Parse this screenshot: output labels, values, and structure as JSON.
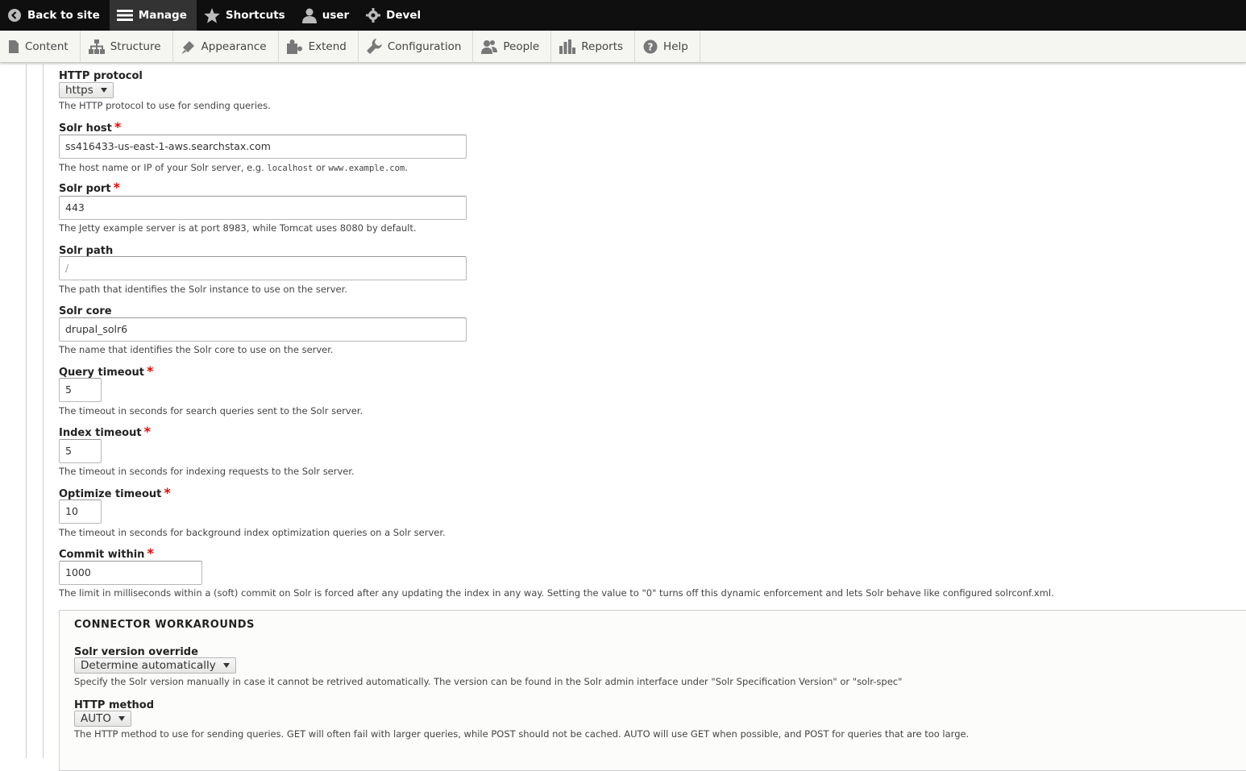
{
  "toolbar": {
    "items": [
      {
        "label": "Back to site",
        "icon": "back-circle-icon"
      },
      {
        "label": "Manage",
        "icon": "menu-icon"
      },
      {
        "label": "Shortcuts",
        "icon": "star-icon"
      },
      {
        "label": "user",
        "icon": "user-icon"
      },
      {
        "label": "Devel",
        "icon": "gear-icon"
      }
    ]
  },
  "tray": {
    "items": [
      {
        "label": "Content",
        "icon": "file-icon"
      },
      {
        "label": "Structure",
        "icon": "sitemap-icon"
      },
      {
        "label": "Appearance",
        "icon": "paintbrush-icon"
      },
      {
        "label": "Extend",
        "icon": "puzzle-icon"
      },
      {
        "label": "Configuration",
        "icon": "wrench-icon"
      },
      {
        "label": "People",
        "icon": "people-icon"
      },
      {
        "label": "Reports",
        "icon": "bar-chart-icon"
      },
      {
        "label": "Help",
        "icon": "help-icon"
      }
    ]
  },
  "form": {
    "http_protocol": {
      "label": "HTTP protocol",
      "value": "https",
      "description": "The HTTP protocol to use for sending queries."
    },
    "solr_host": {
      "label": "Solr host",
      "value": "ss416433-us-east-1-aws.searchstax.com",
      "desc_before": "The host name or IP of your Solr server, e.g. ",
      "code1": "localhost",
      "desc_mid": " or ",
      "code2": "www.example.com",
      "desc_after": "."
    },
    "solr_port": {
      "label": "Solr port",
      "value": "443",
      "description": "The Jetty example server is at port 8983, while Tomcat uses 8080 by default."
    },
    "solr_path": {
      "label": "Solr path",
      "value": "/",
      "description": "The path that identifies the Solr instance to use on the server."
    },
    "solr_core": {
      "label": "Solr core",
      "value": "drupal_solr6",
      "description": "The name that identifies the Solr core to use on the server."
    },
    "query_timeout": {
      "label": "Query timeout",
      "value": "5",
      "description": "The timeout in seconds for search queries sent to the Solr server."
    },
    "index_timeout": {
      "label": "Index timeout",
      "value": "5",
      "description": "The timeout in seconds for indexing requests to the Solr server."
    },
    "optimize_timeout": {
      "label": "Optimize timeout",
      "value": "10",
      "description": "The timeout in seconds for background index optimization queries on a Solr server."
    },
    "commit_within": {
      "label": "Commit within",
      "value": "1000",
      "description": "The limit in milliseconds within a (soft) commit on Solr is forced after any updating the index in any way. Setting the value to \"0\" turns off this dynamic enforcement and lets Solr behave like configured solrconf.xml."
    },
    "required_marker": "*"
  },
  "workarounds": {
    "legend": "CONNECTOR WORKAROUNDS",
    "solr_version": {
      "label": "Solr version override",
      "value": "Determine automatically",
      "description": "Specify the Solr version manually in case it cannot be retrived automatically. The version can be found in the Solr admin interface under \"Solr Specification Version\" or \"solr-spec\""
    },
    "http_method": {
      "label": "HTTP method",
      "value": "AUTO",
      "description": "The HTTP method to use for sending queries. GET will often fail with larger queries, while POST should not be cached. AUTO will use GET when possible, and POST for queries that are too large."
    }
  }
}
